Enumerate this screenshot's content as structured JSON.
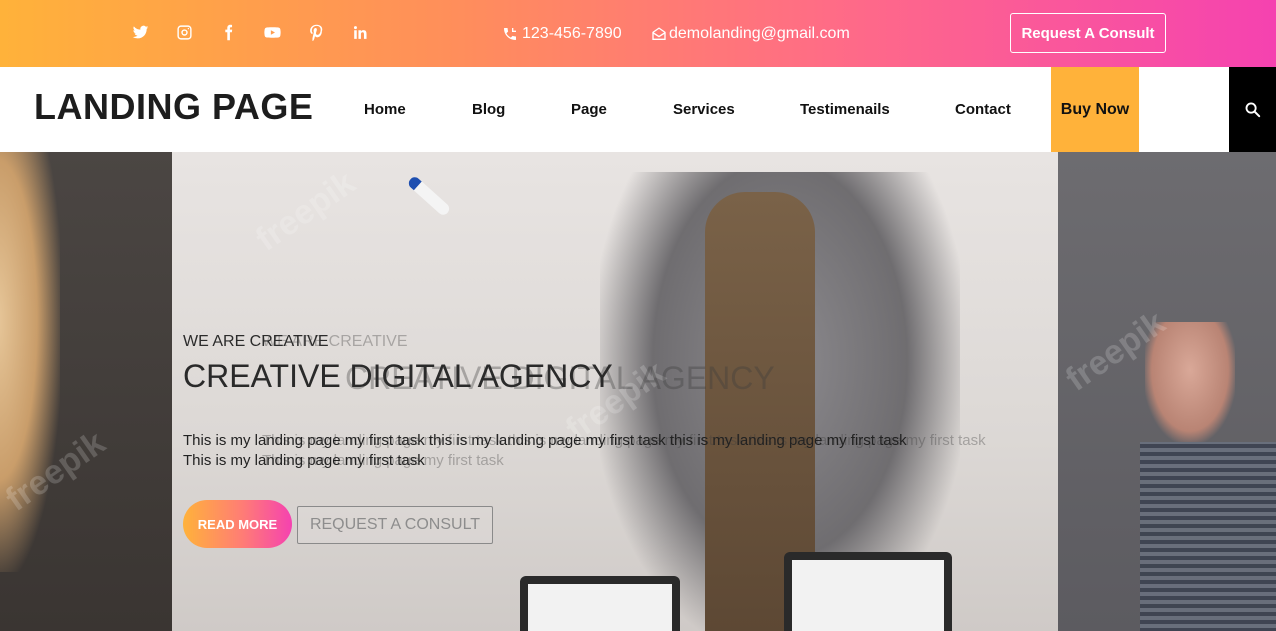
{
  "topbar": {
    "social_icons": [
      "twitter-icon",
      "instagram-icon",
      "facebook-icon",
      "youtube-icon",
      "pinterest-icon",
      "linkedin-icon"
    ],
    "phone": "123-456-7890",
    "email": "demolanding@gmail.com",
    "consult_label": "Request A Consult"
  },
  "navbar": {
    "logo": "LANDING PAGE",
    "items": [
      {
        "label": "Home"
      },
      {
        "label": "Blog"
      },
      {
        "label": "Page"
      },
      {
        "label": "Services"
      },
      {
        "label": "Testimenails"
      },
      {
        "label": "Contact"
      }
    ],
    "buy_now": "Buy Now",
    "search_icon": "search-icon"
  },
  "hero": {
    "eyebrow": "WE ARE CREATIVE",
    "headline": "CREATIVE DIGITAL AGENCY",
    "paragraph_line1": "This is my landing page my first task this is my landing page my first task this is my landing page my first task",
    "paragraph_line2": "This is my landing page my first task",
    "read_more": "READ MORE",
    "request_consult": "REQUEST A CONSULT",
    "watermark": "freepik"
  },
  "colors": {
    "gradient_start": "#ffb23a",
    "gradient_end": "#f542b0",
    "buy_now_bg": "#ffb23a",
    "search_bg": "#000000"
  }
}
